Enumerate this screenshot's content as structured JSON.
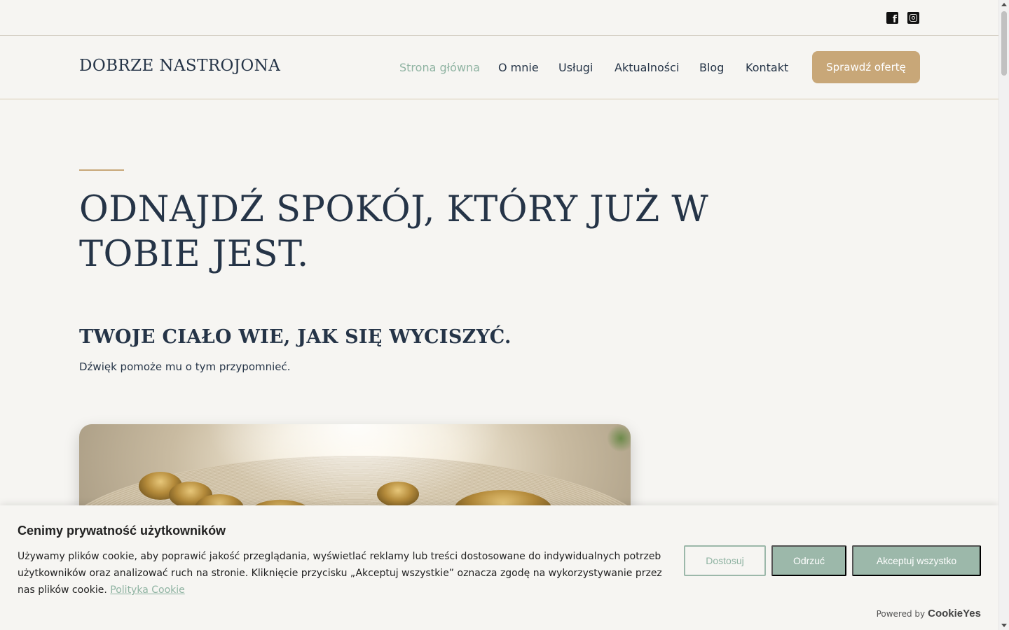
{
  "social": {
    "facebook": "facebook-square-icon",
    "instagram": "instagram-icon"
  },
  "header": {
    "logo": "DOBRZE NASTROJONA",
    "nav": [
      {
        "label": "Strona główna",
        "active": true
      },
      {
        "label": "O mnie"
      },
      {
        "label": "Usługi"
      },
      {
        "label": "Aktualności"
      },
      {
        "label": "Blog"
      },
      {
        "label": "Kontakt"
      }
    ],
    "cta": "Sprawdź ofertę"
  },
  "hero": {
    "title": "ODNAJDŹ SPOKÓJ, KTÓRY JUŻ W TOBIE JEST.",
    "subtitle": "TWOJE CIAŁO WIE, JAK SIĘ WYCISZYĆ.",
    "text": "Dźwięk pomoże mu o tym przypomnieć."
  },
  "cookie": {
    "title": "Cenimy prywatność użytkowników",
    "text": "Używamy plików cookie, aby poprawić jakość przeglądania, wyświetlać reklamy lub treści dostosowane do indywidualnych potrzeb użytkowników oraz analizować ruch na stronie. Kliknięcie przycisku „Akceptuj wszystkie” oznacza zgodę na wykorzystywanie przez nas plików cookie.",
    "link": "Polityka Cookie",
    "customize": "Dostosuj",
    "reject": "Odrzuć",
    "accept": "Akceptuj wszystko",
    "powered_by": "Powered by",
    "brand": "CookieYes"
  },
  "colors": {
    "accent_gold": "#c8a778",
    "accent_sage": "#8fb3a2",
    "text_navy": "#253447",
    "background": "#f6f5f2"
  }
}
